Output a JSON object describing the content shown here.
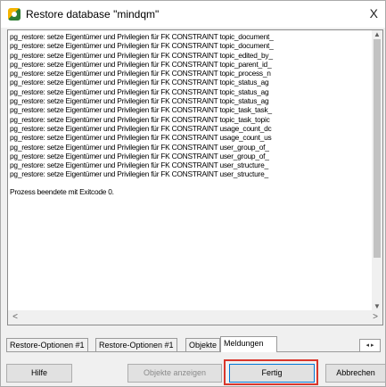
{
  "window": {
    "title": "Restore database \"mindqm\"",
    "close_glyph": "X",
    "icon": "database-restore-icon"
  },
  "log": {
    "lines": [
      "pg_restore: setze Eigentümer und Privilegien für FK CONSTRAINT topic_document_",
      "pg_restore: setze Eigentümer und Privilegien für FK CONSTRAINT topic_document_",
      "pg_restore: setze Eigentümer und Privilegien für FK CONSTRAINT topic_edited_by_",
      "pg_restore: setze Eigentümer und Privilegien für FK CONSTRAINT topic_parent_id_",
      "pg_restore: setze Eigentümer und Privilegien für FK CONSTRAINT topic_process_n",
      "pg_restore: setze Eigentümer und Privilegien für FK CONSTRAINT topic_status_ag",
      "pg_restore: setze Eigentümer und Privilegien für FK CONSTRAINT topic_status_ag",
      "pg_restore: setze Eigentümer und Privilegien für FK CONSTRAINT topic_status_ag",
      "pg_restore: setze Eigentümer und Privilegien für FK CONSTRAINT topic_task_task_",
      "pg_restore: setze Eigentümer und Privilegien für FK CONSTRAINT topic_task_topic",
      "pg_restore: setze Eigentümer und Privilegien für FK CONSTRAINT usage_count_dc",
      "pg_restore: setze Eigentümer und Privilegien für FK CONSTRAINT usage_count_us",
      "pg_restore: setze Eigentümer und Privilegien für FK CONSTRAINT user_group_of_",
      "pg_restore: setze Eigentümer und Privilegien für FK CONSTRAINT user_group_of_",
      "pg_restore: setze Eigentümer und Privilegien für FK CONSTRAINT user_structure_",
      "pg_restore: setze Eigentümer und Privilegien für FK CONSTRAINT user_structure_"
    ],
    "exit_message": "Prozess beendete mit Exitcode 0.",
    "scroll_up": "▲",
    "scroll_down": "▼",
    "scroll_left": "<",
    "scroll_right": ">"
  },
  "tabs": {
    "items": [
      "Restore-Optionen #1",
      "Restore-Optionen #1",
      "Objekte",
      "Meldungen"
    ],
    "active": "Meldungen",
    "nav": "◂ ▸"
  },
  "buttons": {
    "help": "Hilfe",
    "show_objects": "Objekte anzeigen",
    "done": "Fertig",
    "cancel": "Abbrechen"
  }
}
